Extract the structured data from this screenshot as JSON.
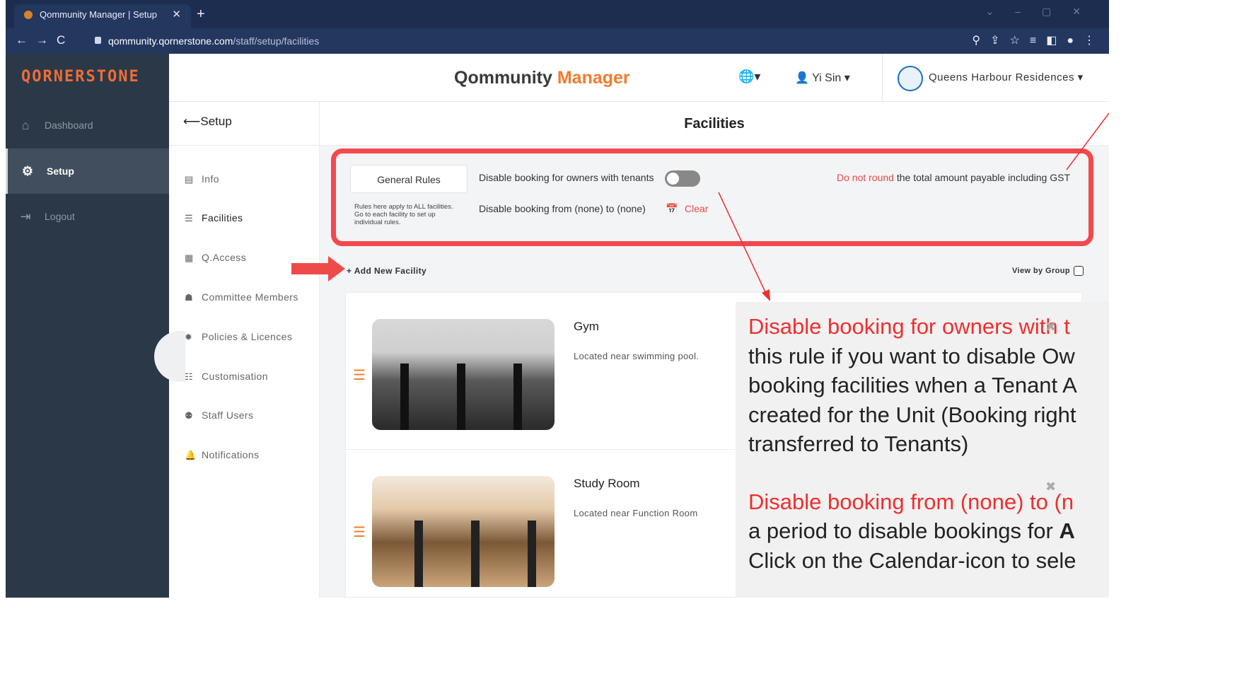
{
  "browser": {
    "tab_title": "Qommunity Manager | Setup",
    "tab_close": "✕",
    "new_tab": "+",
    "url_host": "qommunity.qornerstone.com",
    "url_path": "/staff/setup/facilities"
  },
  "sidebar": {
    "logo": "QORNERSTONE",
    "items": [
      {
        "label": "Dashboard",
        "icon": "home-icon"
      },
      {
        "label": "Setup",
        "icon": "gear-icon"
      },
      {
        "label": "Logout",
        "icon": "logout-icon"
      }
    ]
  },
  "header": {
    "brand_prefix": "Qommunity ",
    "brand_suffix": "Manager",
    "user_name": "Yi Sin",
    "condo_name": "Queens Harbour Residences"
  },
  "subnav": {
    "back_label": "Setup",
    "items": [
      {
        "label": "Info",
        "icon": "book-icon"
      },
      {
        "label": "Facilities",
        "icon": "list-icon"
      },
      {
        "label": "Q.Access",
        "icon": "building-icon"
      },
      {
        "label": "Committee Members",
        "icon": "users-icon"
      },
      {
        "label": "Policies & Licences",
        "icon": "certificate-icon"
      },
      {
        "label": "Customisation",
        "icon": "sliders-icon"
      },
      {
        "label": "Staff Users",
        "icon": "user-cog-icon"
      },
      {
        "label": "Notifications",
        "icon": "bell-icon"
      }
    ]
  },
  "page": {
    "title": "Facilities",
    "general_rules": "General Rules",
    "rules_note": "Rules here apply to ALL facilities. Go to each facility to set up individual rules.",
    "disable_owners": "Disable booking for owners with tenants",
    "disable_owners_enabled": false,
    "disable_from": "Disable booking from (none)  to  (none)",
    "clear": "Clear",
    "round_red": "Do not round",
    "round_rest": " the total amount payable including GST",
    "add_new": "+ Add New Facility",
    "view_by_group": "View by Group"
  },
  "facilities": [
    {
      "name": "Gym",
      "description": "Located near swimming pool."
    },
    {
      "name": "Study Room",
      "description": "Located near Function Room"
    }
  ],
  "tooltip": {
    "p1_red": "Disable booking for owners with t",
    "p1_lines": [
      "this rule if you want to disable Ow",
      "booking facilities when a Tenant A",
      "created for the Unit (Booking right",
      "transferred to Tenants)"
    ],
    "p2_red": "Disable booking from (none) to (n",
    "p2_line1_pre": "a period to disable bookings for ",
    "p2_line1_bold": "A",
    "p2_line2": "Click on the Calendar-icon to sele"
  }
}
